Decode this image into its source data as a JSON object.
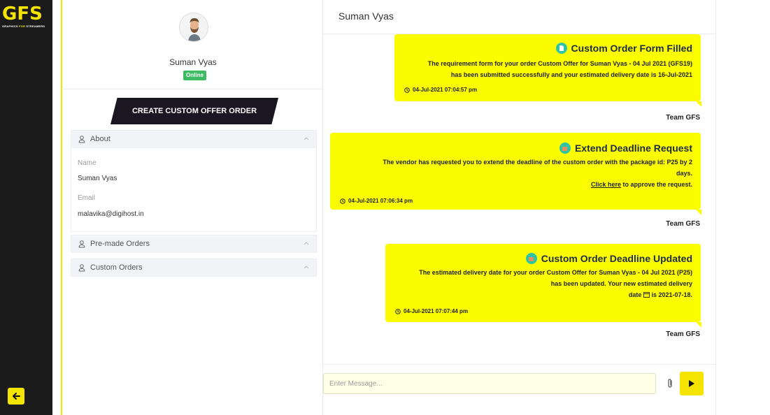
{
  "brand": {
    "logo_main": "GFS",
    "logo_tag_a": "GRAPHICS ",
    "logo_tag_b": "FOR",
    "logo_tag_c": " STREAMERS"
  },
  "profile": {
    "name": "Suman Vyas",
    "status": "Online",
    "cta_label": "CREATE CUSTOM OFFER ORDER",
    "sections": {
      "about": "About",
      "premade": "Pre-made Orders",
      "custom": "Custom Orders"
    },
    "fields": {
      "name_label": "Name",
      "name_value": "Suman Vyas",
      "email_label": "Email",
      "email_value": "malavika@digihost.in"
    }
  },
  "chat": {
    "header": "Suman Vyas",
    "messages": [
      {
        "title": "Custom Order Form Filled",
        "line1": "The requirement form for your order Custom Offer for Suman Vyas - 04 Jul 2021 (GFS19)",
        "line2": "has been submitted successfully and your estimated delivery date is 16-Jul-2021",
        "time": "04-Jul-2021 07:04:57 pm",
        "sender": "Team GFS"
      },
      {
        "title": "Extend Deadline Request",
        "line1": "The vendor has requested you to extend the deadline of the custom order with the package id: P25 by 2",
        "line2": "days.",
        "link": "Click here",
        "line3": " to approve the request.",
        "time": "04-Jul-2021 07:06:34 pm",
        "sender": "Team GFS"
      },
      {
        "title": "Custom Order Deadline Updated",
        "line1": "The estimated delivery date for your order Custom Offer for Suman Vyas - 04 Jul 2021 (P25)",
        "line2": "has been updated. Your new estimated delivery",
        "line3a": "date",
        "line3b": " is 2021-07-18.",
        "time": "04-Jul-2021 07:07:44 pm",
        "sender": "Team GFS"
      }
    ],
    "input_placeholder": "Enter Message..."
  },
  "colors": {
    "accent": "#f5e400",
    "bubble": "#fcfc00",
    "rail": "#1b1b1b",
    "badge": "#3dbb62",
    "cta": "#1a1622"
  }
}
